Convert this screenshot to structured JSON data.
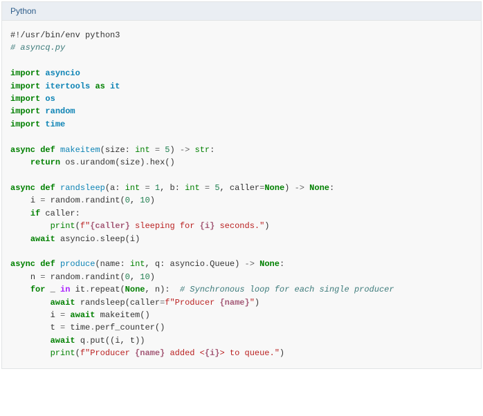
{
  "header": {
    "language": "Python"
  },
  "code": {
    "l1": "#!/usr/bin/env python3",
    "l2": "# asyncq.py",
    "kw_import": "import",
    "kw_as": "as",
    "kw_async": "async",
    "kw_def": "def",
    "kw_return": "return",
    "kw_if": "if",
    "kw_await": "await",
    "kw_for": "for",
    "kw_in": "in",
    "kw_None": "None",
    "mod_asyncio": "asyncio",
    "mod_itertools": "itertools",
    "alias_it": "it",
    "mod_os": "os",
    "mod_random": "random",
    "mod_time": "time",
    "fn_makeitem": "makeitem",
    "fn_randsleep": "randsleep",
    "fn_produce": "produce",
    "id_size": "size",
    "id_a": "a",
    "id_b": "b",
    "id_caller": "caller",
    "id_i": "i",
    "id_n": "n",
    "id_name": "name",
    "id_q": "q",
    "id_t": "t",
    "id_underscore": "_",
    "typ_int": "int",
    "typ_str": "str",
    "attr_urandom": "urandom",
    "attr_hex": "hex",
    "attr_randint": "randint",
    "attr_sleep": "sleep",
    "attr_Queue": "Queue",
    "attr_repeat": "repeat",
    "attr_perf_counter": "perf_counter",
    "attr_put": "put",
    "bi_print": "print",
    "num_5": "5",
    "num_1": "1",
    "num_0": "0",
    "num_10": "10",
    "cmt_sync": "# Synchronous loop for each single producer",
    "f_prefix": "f",
    "dq": "\"",
    "s_rs1a": " sleeping for ",
    "s_rs1b": " seconds.",
    "s_pr1a": "Producer ",
    "s_pr2a": " added <",
    "s_pr2b": "> to queue.",
    "lb_caller": "{caller}",
    "lb_i": "{i}",
    "lb_name": "{name}",
    "op_eq": "=",
    "op_colon": ":",
    "op_arrow": "->",
    "op_dot": ".",
    "op_comma": ",",
    "op_lp": "(",
    "op_rp": ")"
  }
}
